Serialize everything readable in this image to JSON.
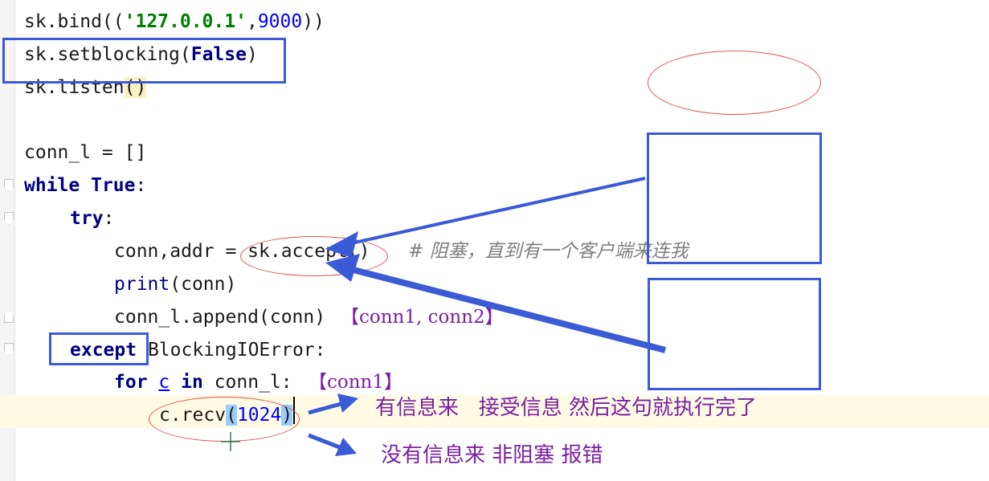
{
  "code": {
    "l1": {
      "a": "sk.bind((",
      "b": "'127.0.0.1'",
      "c": ",",
      "d": "9000",
      "e": "))"
    },
    "l2": {
      "a": "sk.setblocking(",
      "b": "False",
      "c": ")"
    },
    "l3": {
      "a": "sk.listen",
      "b": "()"
    },
    "l4": {
      "a": "conn_l = []"
    },
    "l5": {
      "kw1": "while",
      "kw2": "True",
      "rest": ":"
    },
    "l6": {
      "kw": "try",
      "rest": ":"
    },
    "l7": {
      "a": "conn,addr = sk.accept()",
      "comment": "# 阻塞，直到有一个客户端来连我"
    },
    "l8": {
      "fn": "print",
      "rest": "(conn)"
    },
    "l9": {
      "a": "conn_l.append(conn)",
      "note": "【conn1, conn2】"
    },
    "l10": {
      "kw": "except",
      "rest": " BlockingIOError:"
    },
    "l11": {
      "kw1": "for",
      "var": "c",
      "kw2": "in",
      "rest": "conn_l:",
      "note": "【conn1】"
    },
    "l12": {
      "a": "c.recv",
      "p1": "(",
      "num": "1024",
      "p2": ")"
    }
  },
  "annotations": {
    "has_info": "有信息来   接受信息 然后这句就执行完了",
    "no_info": "没有信息来 非阻塞 报错"
  },
  "colors": {
    "annotation_blue": "#3b5bd6",
    "annotation_red": "#e0524a",
    "annotation_purple": "#7b1fa2",
    "current_line": "#fffae3"
  }
}
